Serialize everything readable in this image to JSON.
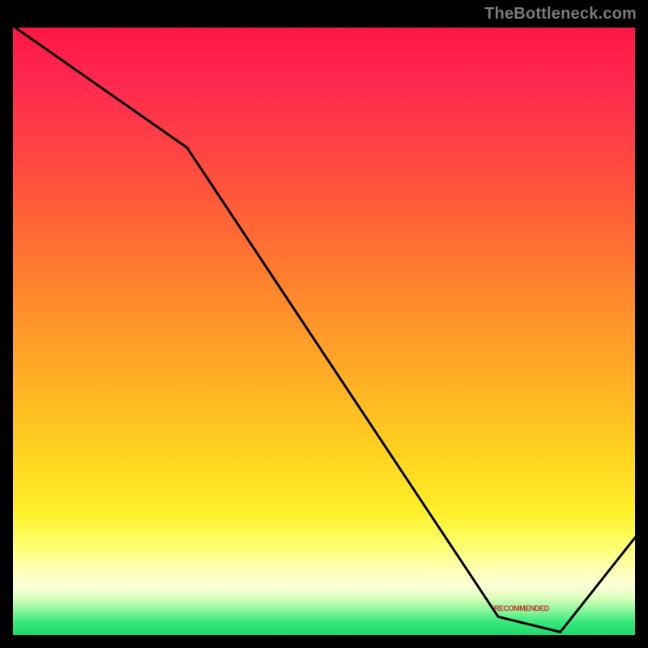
{
  "watermark": "TheBottleneck.com",
  "annotation_label": "RECOMMENDED",
  "colors": {
    "line": "#000000",
    "annotation": "#d02a2a"
  },
  "chart_data": {
    "type": "line",
    "title": "",
    "xlabel": "",
    "ylabel": "",
    "xlim": [
      0,
      100
    ],
    "ylim": [
      0,
      100
    ],
    "annotation": {
      "label": "RECOMMENDED",
      "x": 82,
      "y": 4
    },
    "series": [
      {
        "name": "curve",
        "x": [
          0,
          28,
          78,
          88,
          100
        ],
        "values": [
          100,
          80,
          3,
          0.5,
          16
        ]
      }
    ]
  }
}
